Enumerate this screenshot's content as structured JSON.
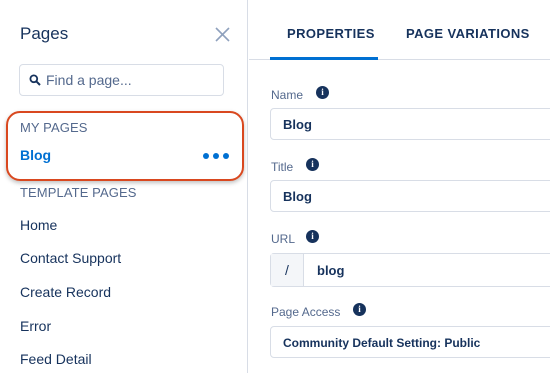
{
  "pages_panel": {
    "title": "Pages",
    "close_icon": "close-icon",
    "search": {
      "placeholder": "Find a page...",
      "value": "",
      "icon": "search-icon"
    },
    "my_pages_label": "MY PAGES",
    "my_pages": [
      {
        "label": "Blog",
        "selected": true,
        "more_icon": "more-actions-icon"
      }
    ],
    "template_pages_label": "TEMPLATE PAGES",
    "template_pages": [
      {
        "label": "Home"
      },
      {
        "label": "Contact Support"
      },
      {
        "label": "Create Record"
      },
      {
        "label": "Error"
      },
      {
        "label": "Feed Detail"
      }
    ]
  },
  "properties_panel": {
    "tabs": [
      {
        "label": "PROPERTIES",
        "active": true
      },
      {
        "label": "PAGE VARIATIONS",
        "active": false
      }
    ],
    "fields": {
      "name": {
        "label": "Name",
        "value": "Blog"
      },
      "title": {
        "label": "Title",
        "value": "Blog"
      },
      "url": {
        "label": "URL",
        "prefix": "/",
        "value": "blog"
      },
      "page_access": {
        "label": "Page Access",
        "value": "Community Default Setting: Public"
      }
    },
    "info_glyph": "i"
  },
  "colors": {
    "brand_blue": "#0070d2",
    "text_navy": "#16325c",
    "muted_text": "#54698d",
    "highlight_ring": "#d9481f"
  }
}
